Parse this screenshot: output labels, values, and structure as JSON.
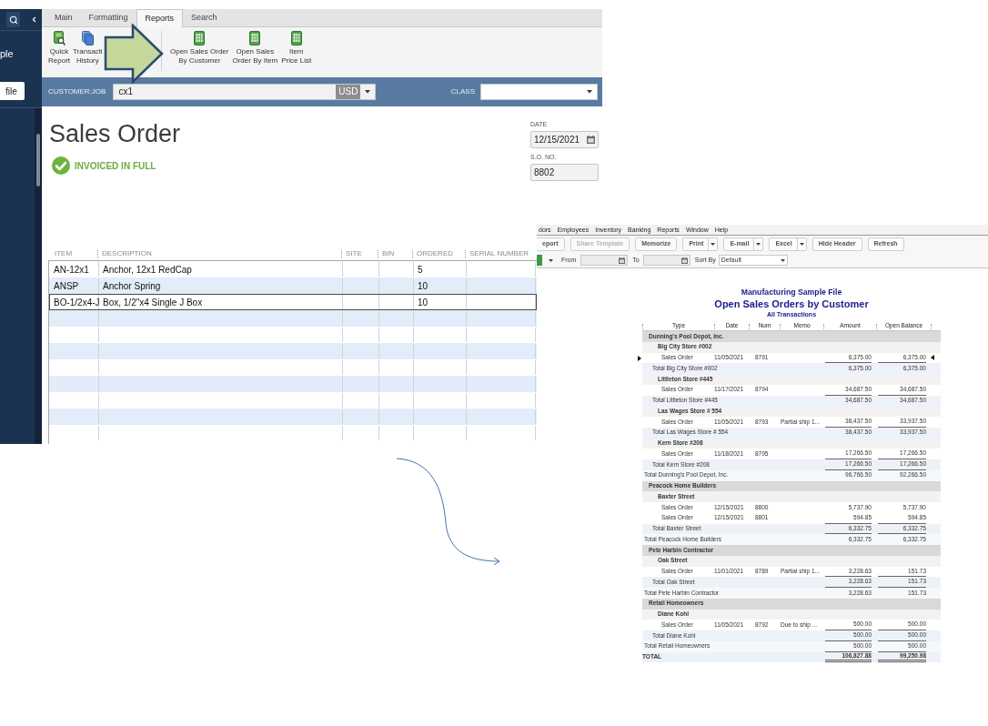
{
  "sales_order": {
    "sidebar": {
      "title_fragment": "ple",
      "button": "file"
    },
    "tabs": [
      {
        "label": "Main",
        "selected": false
      },
      {
        "label": "Formatting",
        "selected": false
      },
      {
        "label": "Reports",
        "selected": true
      },
      {
        "label": "Search",
        "selected": false
      }
    ],
    "toolbar_groups": [
      [
        {
          "kind": "quick_report",
          "lines": [
            "Quick",
            "Report"
          ]
        },
        {
          "kind": "history",
          "lines": [
            "Transacti",
            "History"
          ]
        }
      ],
      [
        {
          "kind": "report",
          "lines": [
            "Open Sales Order",
            "By Customer"
          ]
        },
        {
          "kind": "report",
          "lines": [
            "Open Sales",
            "Order By Item"
          ]
        },
        {
          "kind": "report",
          "lines": [
            "Item",
            "Price List"
          ]
        }
      ]
    ],
    "customer_job": {
      "label": "CUSTOMER:JOB",
      "value": "cx1",
      "currency": "USD"
    },
    "class_field": {
      "label": "CLASS"
    },
    "title": "Sales Order",
    "status": "INVOICED IN FULL",
    "date": {
      "label": "DATE",
      "value": "12/15/2021"
    },
    "so_number": {
      "label": "S.O. NO.",
      "value": "8802"
    },
    "columns": [
      "ITEM",
      "DESCRIPTION",
      "SITE",
      "BIN",
      "ORDERED",
      "SERIAL NUMBER"
    ],
    "lines": [
      {
        "item": "AN-12x1",
        "description": "Anchor, 12x1 RedCap",
        "ordered": "5",
        "selected": false
      },
      {
        "item": "ANSP",
        "description": "Anchor Spring",
        "ordered": "10",
        "selected": false
      },
      {
        "item": "BO-1/2x4-J",
        "description": "Box, 1/2\"x4 Single J Box",
        "ordered": "10",
        "selected": true
      }
    ]
  },
  "report": {
    "menu": [
      "dors",
      "Employees",
      "Inventory",
      "Banking",
      "Reports",
      "Window",
      "Help"
    ],
    "buttons": [
      {
        "label": "eport",
        "disabled": false,
        "dropdown": false
      },
      {
        "label": "Share Template",
        "disabled": true,
        "dropdown": false
      },
      {
        "label": "Memorize",
        "disabled": false,
        "dropdown": false
      },
      {
        "label": "Print",
        "disabled": false,
        "dropdown": true
      },
      {
        "label": "E-mail",
        "disabled": false,
        "dropdown": true
      },
      {
        "label": "Excel",
        "disabled": false,
        "dropdown": true
      },
      {
        "label": "Hide Header",
        "disabled": false,
        "dropdown": false
      },
      {
        "label": "Refresh",
        "disabled": false,
        "dropdown": false
      }
    ],
    "filters": {
      "from_label": "From",
      "to_label": "To",
      "sort_label": "Sort By",
      "sort_value": "Default"
    },
    "company": "Manufacturing Sample File",
    "title": "Open Sales Orders by Customer",
    "subtitle": "All Transactions",
    "columns": [
      "Type",
      "Date",
      "Num",
      "Memo",
      "Amount",
      "Open Balance"
    ],
    "customers": [
      {
        "name": "Dunning's Pool Depot, Inc.",
        "jobs": [
          {
            "name": "Big City Store #002",
            "transactions": [
              {
                "type": "Sales Order",
                "date": "11/05/2021",
                "num": "8791",
                "amount": "6,375.00",
                "open_balance": "6,375.00",
                "selected": true
              }
            ],
            "total": {
              "label": "Total Big City Store #002",
              "amount": "6,375.00",
              "open_balance": "6,375.00"
            }
          },
          {
            "name": "Littleton Store #445",
            "transactions": [
              {
                "type": "Sales Order",
                "date": "11/17/2021",
                "num": "8794",
                "amount": "34,687.50",
                "open_balance": "34,687.50",
                "selected": false
              }
            ],
            "total": {
              "label": "Total Littleton Store #445",
              "amount": "34,687.50",
              "open_balance": "34,687.50"
            }
          },
          {
            "name": "Las Wages Store # 554",
            "transactions": [
              {
                "type": "Sales Order",
                "date": "11/05/2021",
                "num": "8793",
                "memo": "Partial ship 1...",
                "amount": "38,437.50",
                "open_balance": "33,937.50",
                "selected": false
              }
            ],
            "total": {
              "label": "Total Las Wages Store # 554",
              "amount": "38,437.50",
              "open_balance": "33,937.50"
            }
          },
          {
            "name": "Kern Store #208",
            "transactions": [
              {
                "type": "Sales Order",
                "date": "11/18/2021",
                "num": "8795",
                "amount": "17,266.50",
                "open_balance": "17,266.50",
                "selected": false
              }
            ],
            "total": {
              "label": "Total Kern Store #208",
              "amount": "17,266.50",
              "open_balance": "17,266.50"
            }
          }
        ],
        "total": {
          "label": "Total Dunning's Pool Depot, Inc.",
          "amount": "96,766.50",
          "open_balance": "92,266.50"
        }
      },
      {
        "name": "Peacock Home Builders",
        "jobs": [
          {
            "name": "Baxter Street",
            "transactions": [
              {
                "type": "Sales Order",
                "date": "12/15/2021",
                "num": "8800",
                "amount": "5,737.90",
                "open_balance": "5,737.90",
                "selected": false
              },
              {
                "type": "Sales Order",
                "date": "12/15/2021",
                "num": "8801",
                "amount": "594.85",
                "open_balance": "594.85",
                "selected": false
              }
            ],
            "total": {
              "label": "Total Baxter Street",
              "amount": "6,332.75",
              "open_balance": "6,332.75"
            }
          }
        ],
        "total": {
          "label": "Total Peacock Home Builders",
          "amount": "6,332.75",
          "open_balance": "6,332.75"
        }
      },
      {
        "name": "Pete Harbin Contractor",
        "jobs": [
          {
            "name": "Oak Street",
            "transactions": [
              {
                "type": "Sales Order",
                "date": "11/01/2021",
                "num": "8789",
                "memo": "Partial ship 1...",
                "amount": "3,228.63",
                "open_balance": "151.73",
                "selected": false
              }
            ],
            "total": {
              "label": "Total Oak Street",
              "amount": "3,228.63",
              "open_balance": "151.73"
            }
          }
        ],
        "total": {
          "label": "Total Pete Harbin Contractor",
          "amount": "3,228.63",
          "open_balance": "151.73"
        }
      },
      {
        "name": "Retail Homeowners",
        "jobs": [
          {
            "name": "Diane Kohl",
            "transactions": [
              {
                "type": "Sales Order",
                "date": "11/05/2021",
                "num": "8792",
                "memo": "Due to ship ...",
                "amount": "500.00",
                "open_balance": "500.00",
                "selected": false
              }
            ],
            "total": {
              "label": "Total Diane Kohl",
              "amount": "500.00",
              "open_balance": "500.00"
            }
          }
        ],
        "total": {
          "label": "Total Retail Homeowners",
          "amount": "500.00",
          "open_balance": "500.00"
        }
      }
    ],
    "grand_total": {
      "label": "TOTAL",
      "amount": "106,827.88",
      "open_balance": "99,250.98"
    }
  }
}
